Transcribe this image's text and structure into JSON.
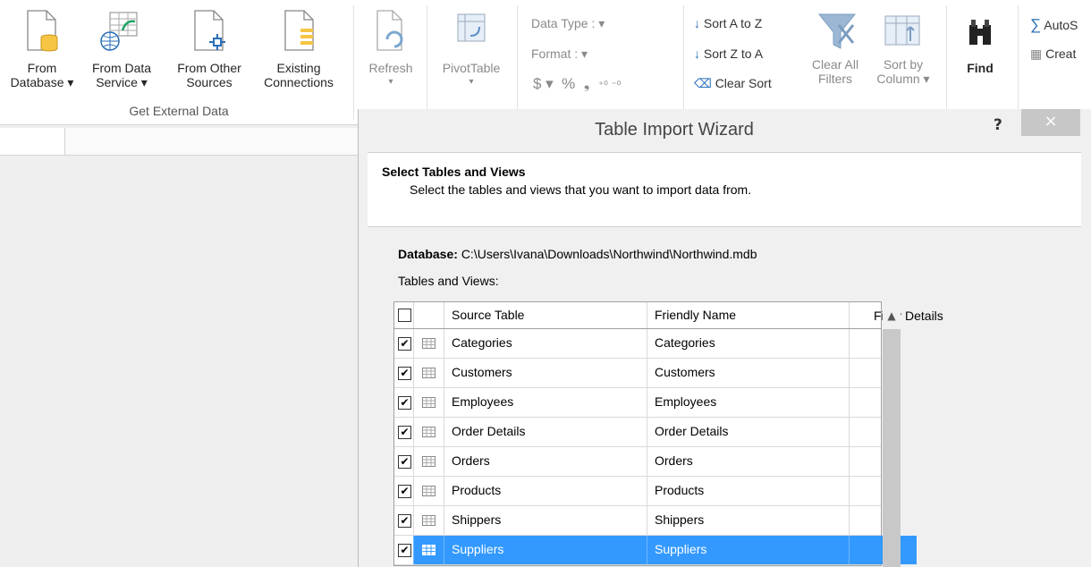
{
  "ribbon": {
    "from_database": [
      "From",
      "Database ▾"
    ],
    "from_data_service": [
      "From Data",
      "Service ▾"
    ],
    "from_other_sources": [
      "From Other",
      "Sources"
    ],
    "existing_connections": [
      "Existing",
      "Connections"
    ],
    "group_label": "Get External Data",
    "refresh": "Refresh",
    "pivottable": "PivotTable",
    "data_type": "Data Type :",
    "format": "Format :",
    "sort_az": "Sort A to Z",
    "sort_za": "Sort Z to A",
    "clear_sort": "Clear Sort",
    "clear_all_filters": [
      "Clear All",
      "Filters"
    ],
    "sort_by_column": [
      "Sort by",
      "Column ▾"
    ],
    "find": "Find",
    "autosum": "AutoS",
    "create": "Creat"
  },
  "dialog": {
    "title": "Table Import Wizard",
    "help": "?",
    "close": "×",
    "header_title": "Select Tables and Views",
    "header_sub": "Select the tables and views that you want to import data from.",
    "db_label": "Database:",
    "db_path": "C:\\Users\\Ivana\\Downloads\\Northwind\\Northwind.mdb",
    "tables_label": "Tables and Views:",
    "columns": [
      "Source Table",
      "Friendly Name",
      "Filter Details"
    ],
    "rows": [
      {
        "source": "Categories",
        "friendly": "Categories",
        "filter": "",
        "checked": true
      },
      {
        "source": "Customers",
        "friendly": "Customers",
        "filter": "",
        "checked": true
      },
      {
        "source": "Employees",
        "friendly": "Employees",
        "filter": "",
        "checked": true
      },
      {
        "source": "Order Details",
        "friendly": "Order Details",
        "filter": "",
        "checked": true
      },
      {
        "source": "Orders",
        "friendly": "Orders",
        "filter": "",
        "checked": true
      },
      {
        "source": "Products",
        "friendly": "Products",
        "filter": "",
        "checked": true
      },
      {
        "source": "Shippers",
        "friendly": "Shippers",
        "filter": "",
        "checked": true
      },
      {
        "source": "Suppliers",
        "friendly": "Suppliers",
        "filter": "",
        "checked": true,
        "selected": true
      }
    ]
  },
  "colors": {
    "selection": "#3399ff",
    "accent_green": "#217346",
    "close_bg": "#c7c7c7"
  }
}
